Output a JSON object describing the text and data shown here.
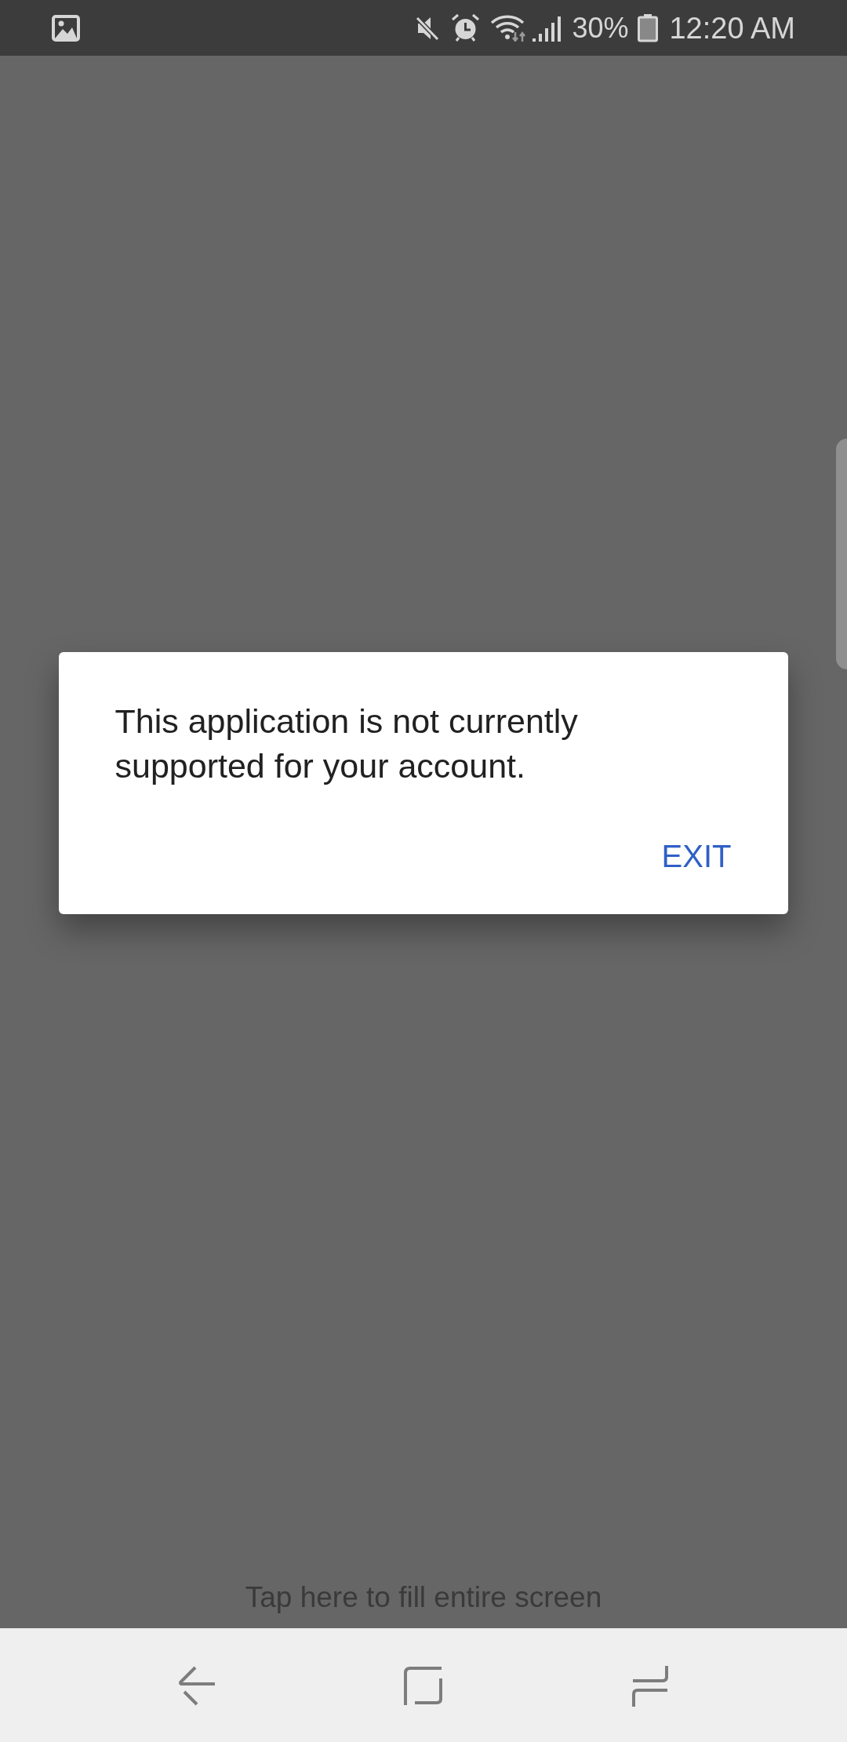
{
  "status_bar": {
    "battery": "30%",
    "time": "12:20 AM"
  },
  "dialog": {
    "message": "This application is not currently supported for your account.",
    "buttons": [
      "EXIT"
    ]
  },
  "hint": "Tap here to fill entire screen"
}
